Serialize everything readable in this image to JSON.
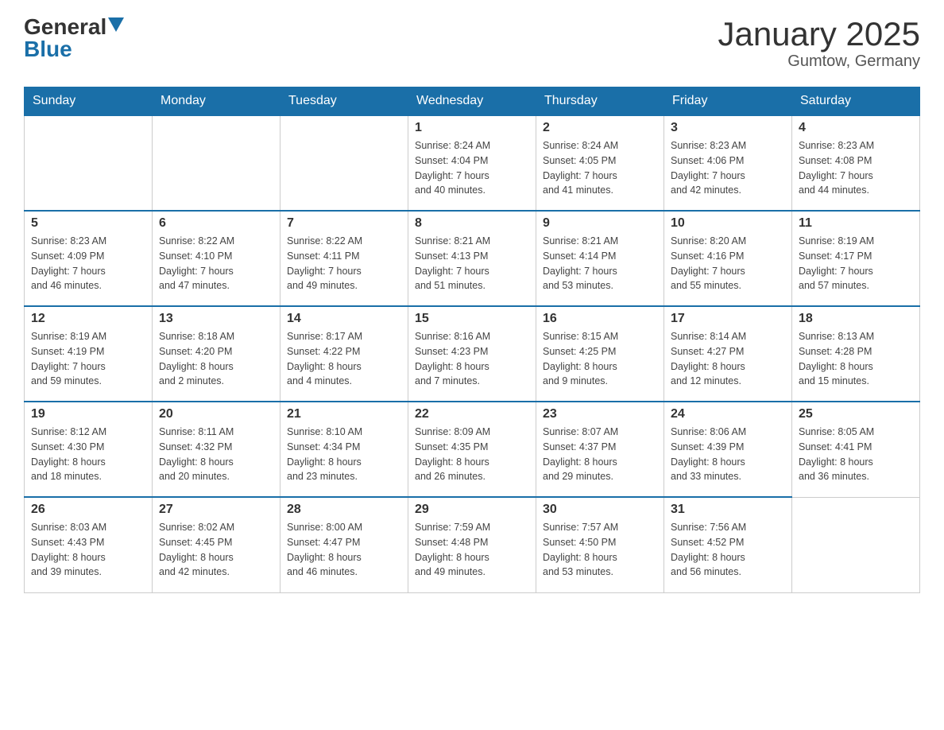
{
  "logo": {
    "general": "General",
    "blue": "Blue"
  },
  "title": "January 2025",
  "subtitle": "Gumtow, Germany",
  "days_of_week": [
    "Sunday",
    "Monday",
    "Tuesday",
    "Wednesday",
    "Thursday",
    "Friday",
    "Saturday"
  ],
  "weeks": [
    [
      {
        "day": "",
        "info": ""
      },
      {
        "day": "",
        "info": ""
      },
      {
        "day": "",
        "info": ""
      },
      {
        "day": "1",
        "info": "Sunrise: 8:24 AM\nSunset: 4:04 PM\nDaylight: 7 hours\nand 40 minutes."
      },
      {
        "day": "2",
        "info": "Sunrise: 8:24 AM\nSunset: 4:05 PM\nDaylight: 7 hours\nand 41 minutes."
      },
      {
        "day": "3",
        "info": "Sunrise: 8:23 AM\nSunset: 4:06 PM\nDaylight: 7 hours\nand 42 minutes."
      },
      {
        "day": "4",
        "info": "Sunrise: 8:23 AM\nSunset: 4:08 PM\nDaylight: 7 hours\nand 44 minutes."
      }
    ],
    [
      {
        "day": "5",
        "info": "Sunrise: 8:23 AM\nSunset: 4:09 PM\nDaylight: 7 hours\nand 46 minutes."
      },
      {
        "day": "6",
        "info": "Sunrise: 8:22 AM\nSunset: 4:10 PM\nDaylight: 7 hours\nand 47 minutes."
      },
      {
        "day": "7",
        "info": "Sunrise: 8:22 AM\nSunset: 4:11 PM\nDaylight: 7 hours\nand 49 minutes."
      },
      {
        "day": "8",
        "info": "Sunrise: 8:21 AM\nSunset: 4:13 PM\nDaylight: 7 hours\nand 51 minutes."
      },
      {
        "day": "9",
        "info": "Sunrise: 8:21 AM\nSunset: 4:14 PM\nDaylight: 7 hours\nand 53 minutes."
      },
      {
        "day": "10",
        "info": "Sunrise: 8:20 AM\nSunset: 4:16 PM\nDaylight: 7 hours\nand 55 minutes."
      },
      {
        "day": "11",
        "info": "Sunrise: 8:19 AM\nSunset: 4:17 PM\nDaylight: 7 hours\nand 57 minutes."
      }
    ],
    [
      {
        "day": "12",
        "info": "Sunrise: 8:19 AM\nSunset: 4:19 PM\nDaylight: 7 hours\nand 59 minutes."
      },
      {
        "day": "13",
        "info": "Sunrise: 8:18 AM\nSunset: 4:20 PM\nDaylight: 8 hours\nand 2 minutes."
      },
      {
        "day": "14",
        "info": "Sunrise: 8:17 AM\nSunset: 4:22 PM\nDaylight: 8 hours\nand 4 minutes."
      },
      {
        "day": "15",
        "info": "Sunrise: 8:16 AM\nSunset: 4:23 PM\nDaylight: 8 hours\nand 7 minutes."
      },
      {
        "day": "16",
        "info": "Sunrise: 8:15 AM\nSunset: 4:25 PM\nDaylight: 8 hours\nand 9 minutes."
      },
      {
        "day": "17",
        "info": "Sunrise: 8:14 AM\nSunset: 4:27 PM\nDaylight: 8 hours\nand 12 minutes."
      },
      {
        "day": "18",
        "info": "Sunrise: 8:13 AM\nSunset: 4:28 PM\nDaylight: 8 hours\nand 15 minutes."
      }
    ],
    [
      {
        "day": "19",
        "info": "Sunrise: 8:12 AM\nSunset: 4:30 PM\nDaylight: 8 hours\nand 18 minutes."
      },
      {
        "day": "20",
        "info": "Sunrise: 8:11 AM\nSunset: 4:32 PM\nDaylight: 8 hours\nand 20 minutes."
      },
      {
        "day": "21",
        "info": "Sunrise: 8:10 AM\nSunset: 4:34 PM\nDaylight: 8 hours\nand 23 minutes."
      },
      {
        "day": "22",
        "info": "Sunrise: 8:09 AM\nSunset: 4:35 PM\nDaylight: 8 hours\nand 26 minutes."
      },
      {
        "day": "23",
        "info": "Sunrise: 8:07 AM\nSunset: 4:37 PM\nDaylight: 8 hours\nand 29 minutes."
      },
      {
        "day": "24",
        "info": "Sunrise: 8:06 AM\nSunset: 4:39 PM\nDaylight: 8 hours\nand 33 minutes."
      },
      {
        "day": "25",
        "info": "Sunrise: 8:05 AM\nSunset: 4:41 PM\nDaylight: 8 hours\nand 36 minutes."
      }
    ],
    [
      {
        "day": "26",
        "info": "Sunrise: 8:03 AM\nSunset: 4:43 PM\nDaylight: 8 hours\nand 39 minutes."
      },
      {
        "day": "27",
        "info": "Sunrise: 8:02 AM\nSunset: 4:45 PM\nDaylight: 8 hours\nand 42 minutes."
      },
      {
        "day": "28",
        "info": "Sunrise: 8:00 AM\nSunset: 4:47 PM\nDaylight: 8 hours\nand 46 minutes."
      },
      {
        "day": "29",
        "info": "Sunrise: 7:59 AM\nSunset: 4:48 PM\nDaylight: 8 hours\nand 49 minutes."
      },
      {
        "day": "30",
        "info": "Sunrise: 7:57 AM\nSunset: 4:50 PM\nDaylight: 8 hours\nand 53 minutes."
      },
      {
        "day": "31",
        "info": "Sunrise: 7:56 AM\nSunset: 4:52 PM\nDaylight: 8 hours\nand 56 minutes."
      },
      {
        "day": "",
        "info": ""
      }
    ]
  ]
}
